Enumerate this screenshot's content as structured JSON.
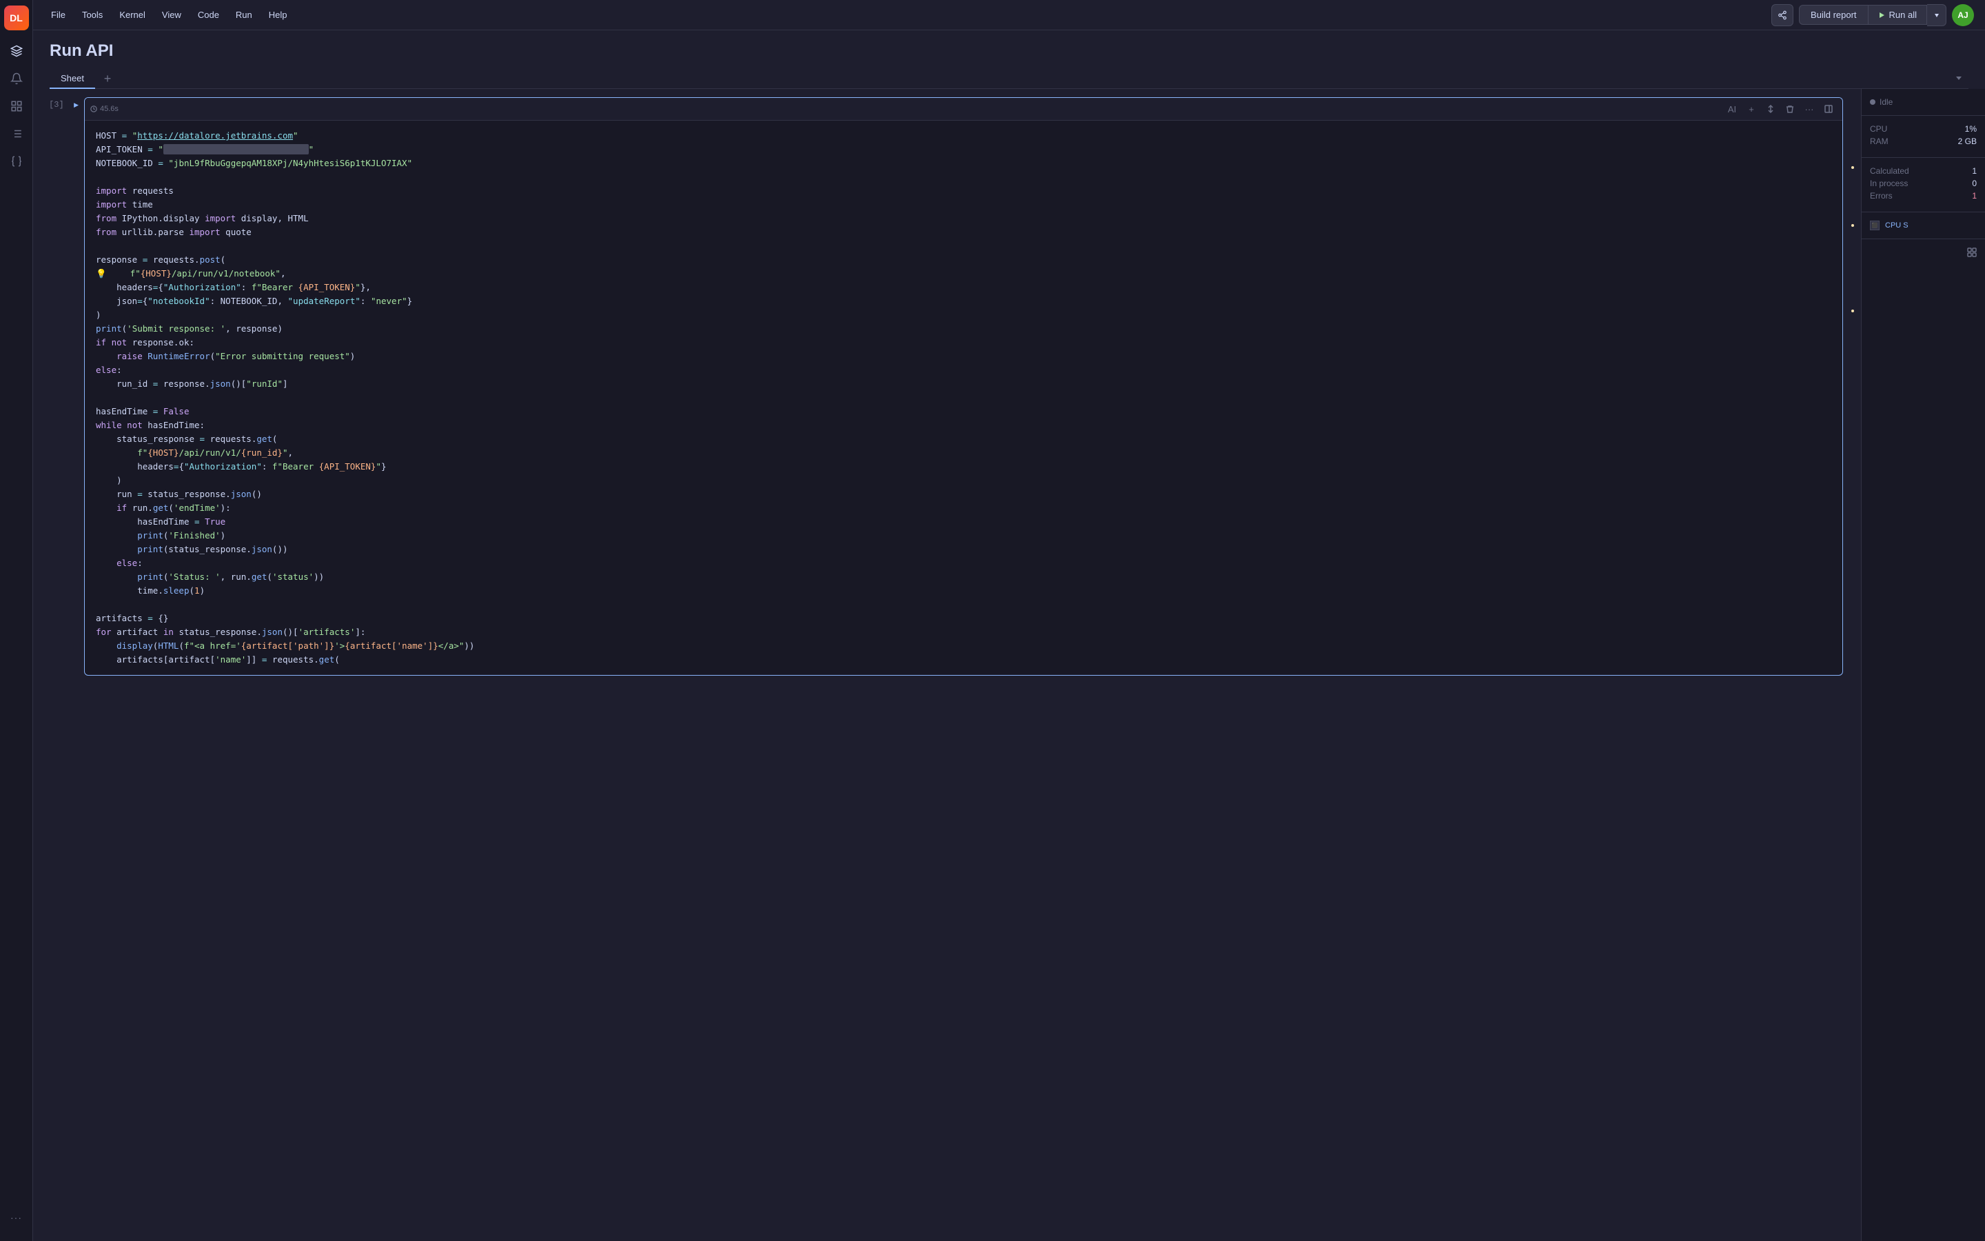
{
  "app": {
    "logo": "DL",
    "title": "Run API"
  },
  "menubar": {
    "items": [
      "File",
      "Tools",
      "Kernel",
      "View",
      "Code",
      "Run",
      "Help"
    ],
    "share_tooltip": "Share",
    "build_report": "Build report",
    "run_all": "Run all"
  },
  "avatar": {
    "initials": "AJ"
  },
  "tabs": {
    "active": "Sheet",
    "add_label": "+"
  },
  "cell": {
    "number": "[3]",
    "execution_time": "45.6s",
    "toolbar": {
      "ai_btn": "AI",
      "add_btn": "+",
      "move_btn": "⇅",
      "delete_btn": "🗑",
      "more_btn": "…",
      "panel_btn": "▣"
    },
    "code_lines": [
      "HOST = \"https://datalore.jetbrains.com\"",
      "API_TOKEN = \"████████████████████████████\"",
      "NOTEBOOK_ID = \"jbnL9fRbuGggepqAM18XPj/N4yhHtesiS6p1tKJLO7IAX\"",
      "",
      "import requests",
      "import time",
      "from IPython.display import display, HTML",
      "from urllib.parse import quote",
      "",
      "response = requests.post(",
      "    f\"{HOST}/api/run/v1/notebook\",",
      "    headers={\"Authorization\": f\"Bearer {API_TOKEN}\"},",
      "    json={\"notebookId\": NOTEBOOK_ID, \"updateReport\": \"never\"}",
      ")",
      "print('Submit response: ', response)",
      "if not response.ok:",
      "    raise RuntimeError(\"Error submitting request\")",
      "else:",
      "    run_id = response.json()[\"runId\"]",
      "",
      "hasEndTime = False",
      "while not hasEndTime:",
      "    status_response = requests.get(",
      "        f\"{HOST}/api/run/v1/{run_id}\",",
      "        headers={\"Authorization\": f\"Bearer {API_TOKEN}\"",
      "    )",
      "    run = status_response.json()",
      "    if run.get('endTime'):",
      "        hasEndTime = True",
      "        print('Finished')",
      "        print(status_response.json())",
      "    else:",
      "        print('Status: ', run.get('status'))",
      "        time.sleep(1)",
      "",
      "artifacts = {}",
      "for artifact in status_response.json()['artifacts']:",
      "    display(HTML(f\"<a href='{artifact['path']}'>{artifact['name']}</a>\"))",
      "    artifacts[artifact['name']] = requests.get("
    ]
  },
  "right_panel": {
    "status": "Idle",
    "cpu_label": "CPU",
    "cpu_value": "1%",
    "ram_label": "RAM",
    "ram_value": "2 GB",
    "calculated_label": "Calculated",
    "calculated_value": "1",
    "in_process_label": "In process",
    "in_process_value": "0",
    "errors_label": "Errors",
    "errors_value": "1",
    "cpu_badge": "CPU S"
  },
  "sidebar": {
    "icons": [
      "layers",
      "bell",
      "grid",
      "list",
      "braces"
    ]
  }
}
